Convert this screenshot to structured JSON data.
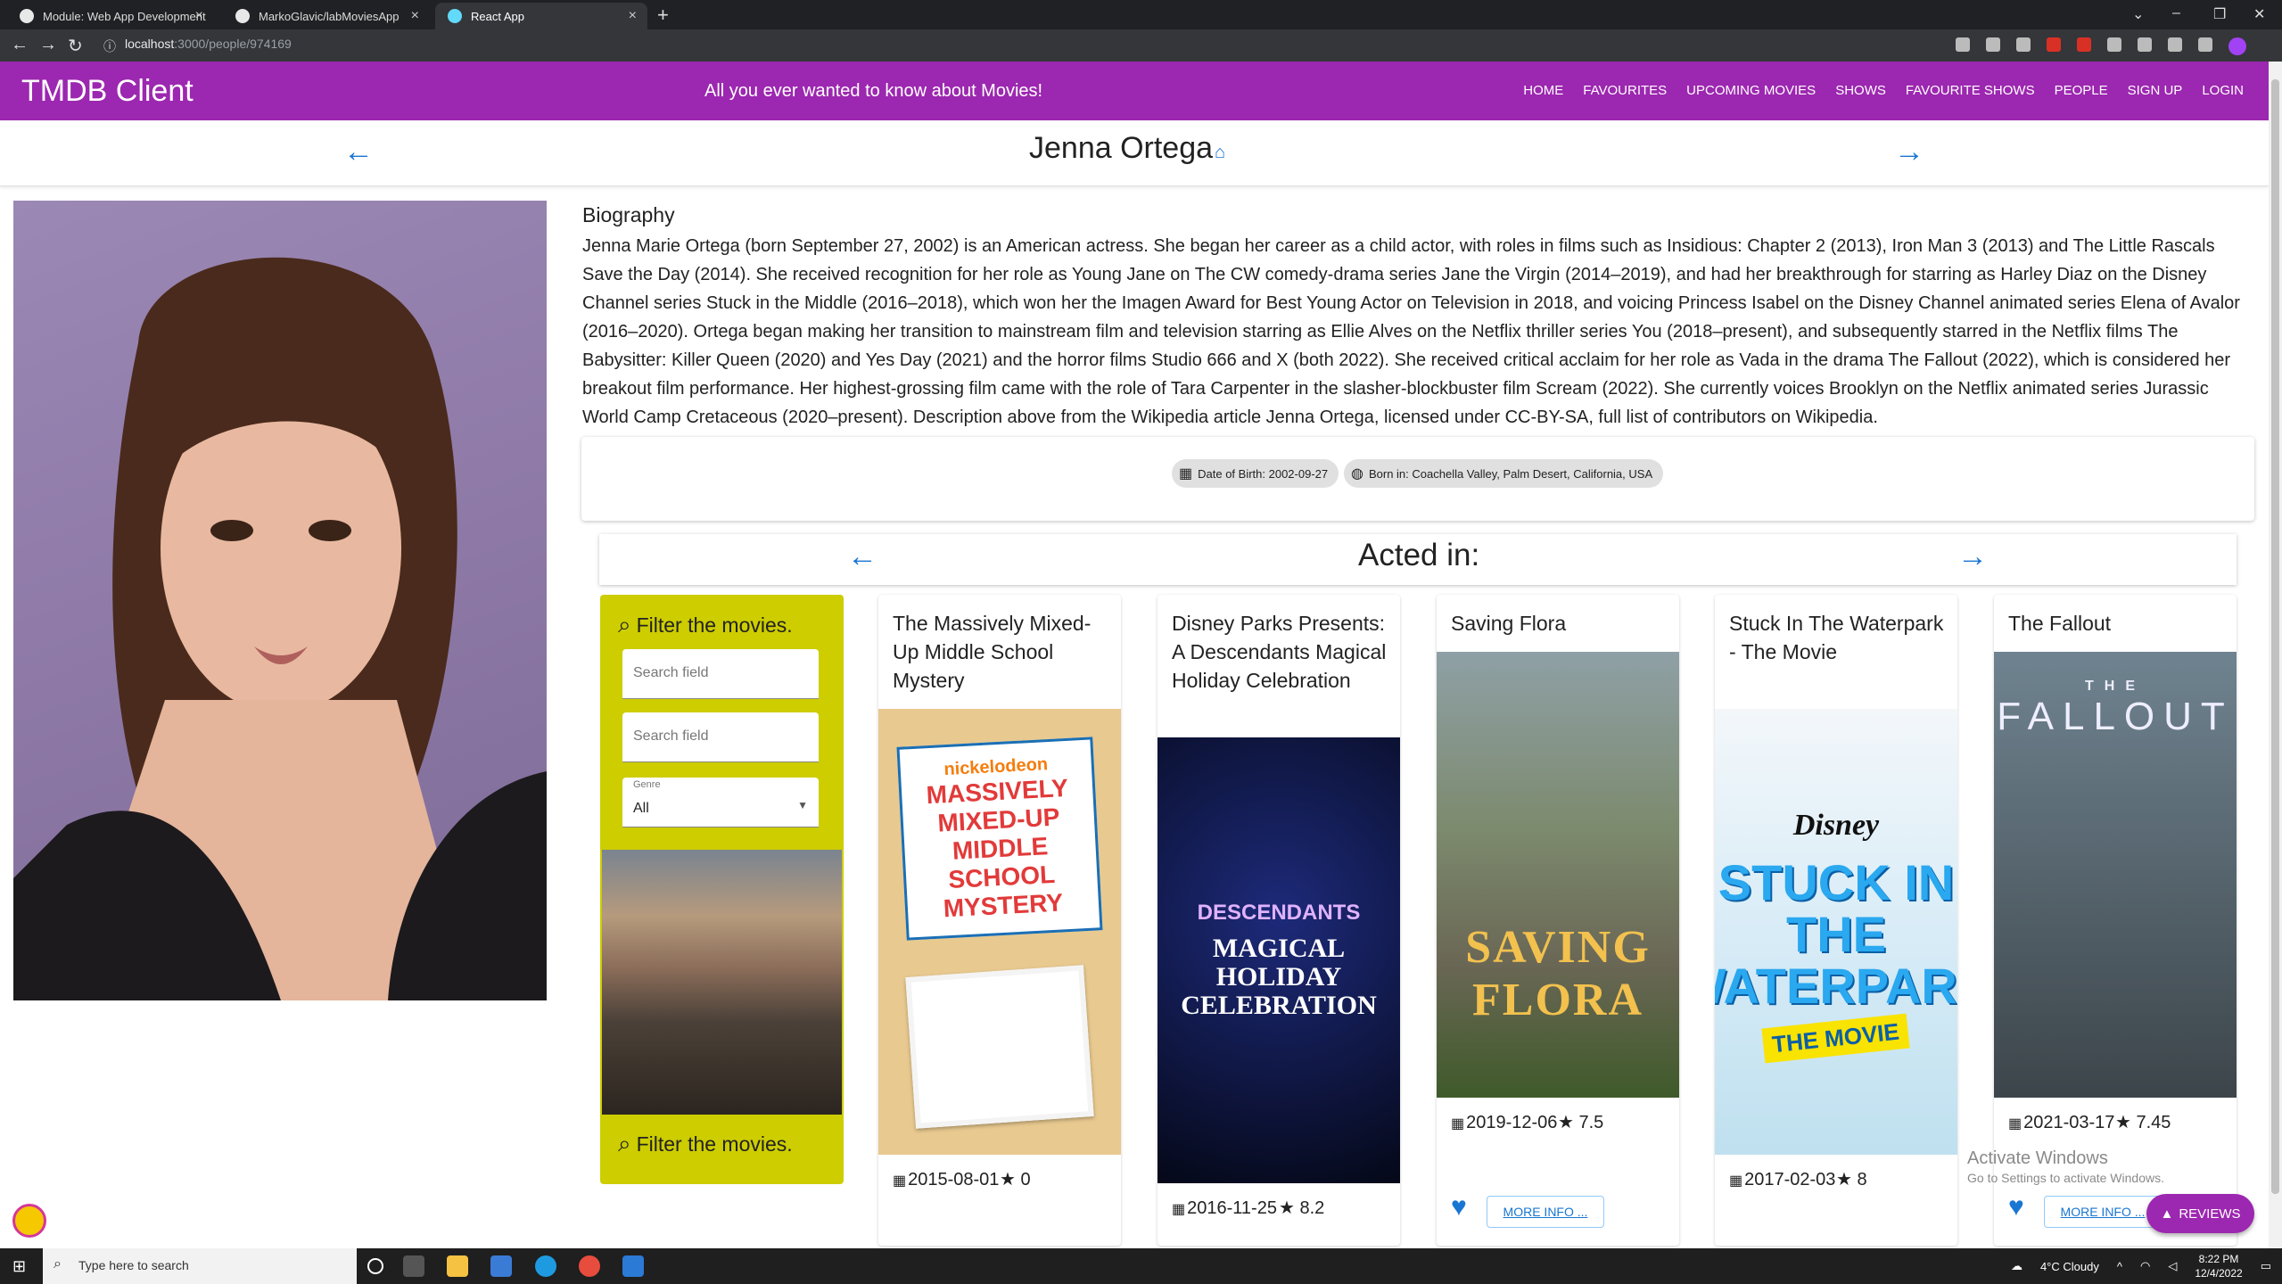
{
  "browser": {
    "tabs": [
      {
        "title": "Module: Web App Development"
      },
      {
        "title": "MarkoGlavic/labMoviesApp"
      },
      {
        "title": "React App"
      }
    ],
    "url_host": "localhost",
    "url_path": ":3000/people/974169"
  },
  "header": {
    "title": "TMDB Client",
    "tagline": "All you ever wanted to know about Movies!",
    "nav": [
      "Home",
      "Favourites",
      "Upcoming Movies",
      "Shows",
      "Favourite Shows",
      "People",
      "Sign Up",
      "Login"
    ]
  },
  "person": {
    "name": "Jenna Ortega",
    "bio_title": "Biography",
    "bio": "Jenna Marie Ortega (born September 27, 2002) is an American actress. She began her career as a child actor, with roles in films such as Insidious: Chapter 2 (2013), Iron Man 3 (2013) and The Little Rascals Save the Day (2014). She received recognition for her role as Young Jane on The CW comedy-drama series Jane the Virgin (2014–2019), and had her breakthrough for starring as Harley Diaz on the Disney Channel series Stuck in the Middle (2016–2018), which won her the Imagen Award for Best Young Actor on Television in 2018, and voicing Princess Isabel on the Disney Channel animated series Elena of Avalor (2016–2020). Ortega began making her transition to mainstream film and television starring as Ellie Alves on the Netflix thriller series You (2018–present), and subsequently starred in the Netflix films The Babysitter: Killer Queen (2020) and Yes Day (2021) and the horror films Studio 666 and X (both 2022). She received critical acclaim for her role as Vada in the drama The Fallout (2022), which is considered her breakout film performance. Her highest-grossing film came with the role of Tara Carpenter in the slasher-blockbuster film Scream (2022). She currently voices Brooklyn on the Netflix animated series Jurassic World Camp Cretaceous (2020–present). Description above from the Wikipedia article Jenna Ortega, licensed under CC-BY-SA, full list of contributors on Wikipedia.",
    "dob_chip": "Date of Birth: 2002-09-27",
    "born_chip": "Born in: Coachella Valley, Palm Desert, California, USA"
  },
  "acted": {
    "title": "Acted in:"
  },
  "filter": {
    "heading": "Filter the movies.",
    "search1_placeholder": "Search field",
    "search2_placeholder": "Search field",
    "genre_label": "Genre",
    "genre_value": "All",
    "footer": "Filter the movies."
  },
  "movies": [
    {
      "title": "The Massively Mixed-Up Middle School Mystery",
      "date": "2015-08-01",
      "rating": "0",
      "poster_text": "MASSIVELY MIXED-UP MIDDLE SCHOOL MYSTERY",
      "poster_sub": "nickelodeon",
      "poster_color": "#e8c98f"
    },
    {
      "title": "Disney Parks Presents: A Descendants Magical Holiday Celebration",
      "date": "2016-11-25",
      "rating": "8.2",
      "poster_text": "MAGICAL HOLIDAY CELEBRATION",
      "poster_sub": "DESCENDANTS",
      "poster_color": "#0b0f3a"
    },
    {
      "title": "Saving Flora",
      "date": "2019-12-06",
      "rating": "7.5",
      "poster_text": "SAVING FLORA",
      "poster_sub": "",
      "poster_color": "#7a8a6a",
      "more": "MORE INFO ..."
    },
    {
      "title": "Stuck In The Waterpark - The Movie",
      "date": "2017-02-03",
      "rating": "8",
      "poster_text": "STUCK IN THE WATERPARK",
      "poster_sub": "THE MOVIE",
      "poster_color": "#d9e8f2"
    },
    {
      "title": "The Fallout",
      "date": "2021-03-17",
      "rating": "7.45",
      "poster_text": "FALLOUT",
      "poster_sub": "THE",
      "poster_color": "#5c6f7c",
      "more": "MORE INFO ..."
    }
  ],
  "overlay": {
    "activate_title": "Activate Windows",
    "activate_sub": "Go to Settings to activate Windows.",
    "reviews": "REVIEWS"
  },
  "taskbar": {
    "search_placeholder": "Type here to search",
    "weather": "4°C  Cloudy",
    "time": "8:22 PM",
    "date": "12/4/2022"
  }
}
